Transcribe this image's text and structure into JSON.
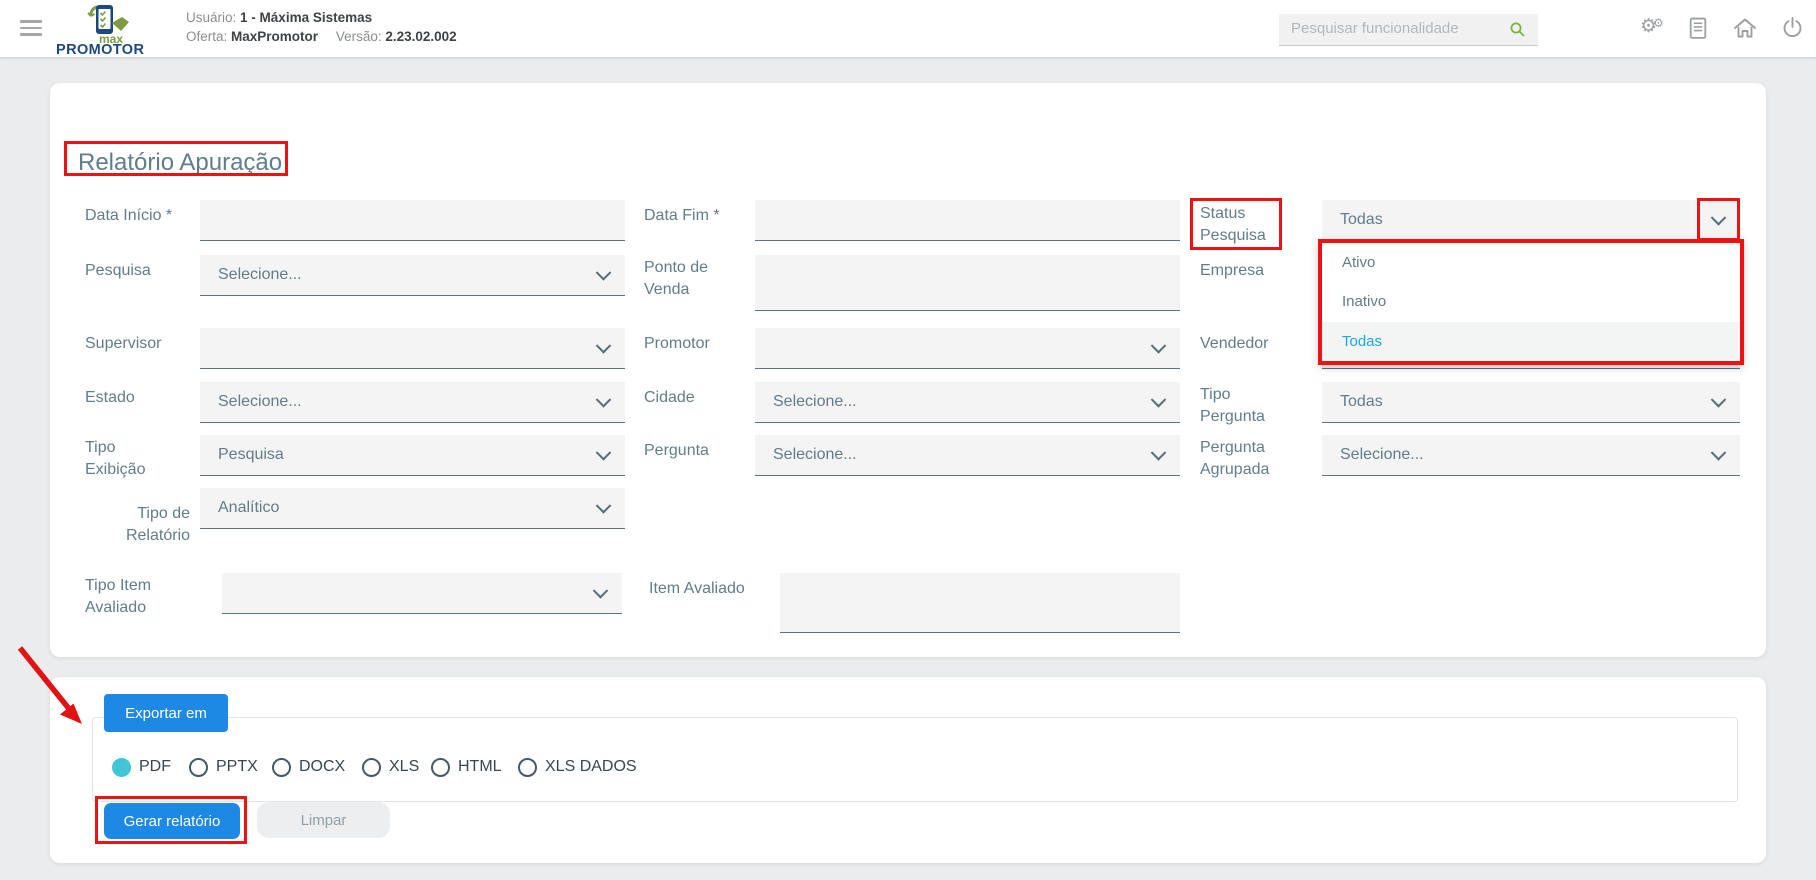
{
  "header": {
    "logo": {
      "top": "max",
      "bottom": "PROMOTOR"
    },
    "user": {
      "label": "Usuário:",
      "value": "1 - Máxima Sistemas"
    },
    "offer": {
      "label": "Oferta:",
      "value": "MaxPromotor"
    },
    "version": {
      "label": "Versão:",
      "value": "2.23.02.002"
    },
    "search": {
      "placeholder": "Pesquisar funcionalidade"
    },
    "icons": [
      "settings-gears",
      "report-document",
      "home",
      "power"
    ]
  },
  "report_form": {
    "title": "Relatório Apuração",
    "fields": {
      "data_inicio": {
        "label": "Data Início *",
        "value": ""
      },
      "data_fim": {
        "label": "Data Fim *",
        "value": ""
      },
      "status_pesquisa": {
        "label": "Status Pesquisa",
        "value": "Todas"
      },
      "pesquisa": {
        "label": "Pesquisa",
        "value": "Selecione..."
      },
      "ponto_de_venda": {
        "label": "Ponto de Venda",
        "value": ""
      },
      "empresa": {
        "label": "Empresa",
        "value": ""
      },
      "supervisor": {
        "label": "Supervisor",
        "value": ""
      },
      "promotor": {
        "label": "Promotor",
        "value": ""
      },
      "vendedor": {
        "label": "Vendedor",
        "value": ""
      },
      "estado": {
        "label": "Estado",
        "value": "Selecione..."
      },
      "cidade": {
        "label": "Cidade",
        "value": "Selecione..."
      },
      "tipo_pergunta": {
        "label": "Tipo Pergunta",
        "value": "Todas"
      },
      "tipo_exibicao": {
        "label": "Tipo Exibição",
        "value": "Pesquisa"
      },
      "pergunta": {
        "label": "Pergunta",
        "value": "Selecione..."
      },
      "pergunta_agrupada": {
        "label": "Pergunta Agrupada",
        "value": "Selecione..."
      },
      "tipo_relatorio": {
        "label": "Tipo de Relatório",
        "value": "Analítico"
      },
      "tipo_item_avaliado": {
        "label": "Tipo Item Avaliado",
        "value": ""
      },
      "item_avaliado": {
        "label": "Item Avaliado",
        "value": ""
      }
    },
    "status_dropdown": {
      "open": true,
      "options": [
        "Ativo",
        "Inativo",
        "Todas"
      ],
      "selected": "Todas"
    }
  },
  "export_panel": {
    "export_button": "Exportar em",
    "formats": [
      "PDF",
      "PPTX",
      "DOCX",
      "XLS",
      "HTML",
      "XLS DADOS"
    ],
    "selected_format": "PDF",
    "generate_button": "Gerar relatório",
    "clear_button": "Limpar"
  },
  "colors": {
    "primary_blue": "#1e88e5",
    "annotation_red": "#ee1313",
    "selected_option_blue": "#1aa7e0",
    "radio_selected_cyan": "#40c5d6",
    "label_gray_blue": "#607d8b"
  }
}
